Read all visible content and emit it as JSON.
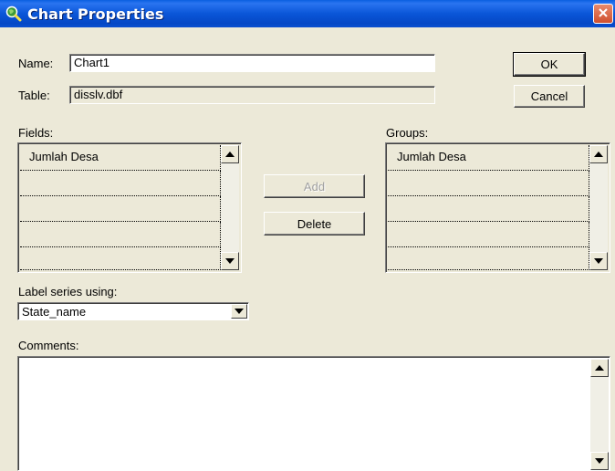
{
  "window": {
    "title": "Chart Properties"
  },
  "form": {
    "name_label": "Name:",
    "name_value": "Chart1",
    "table_label": "Table:",
    "table_value": "disslv.dbf"
  },
  "buttons": {
    "ok": "OK",
    "cancel": "Cancel",
    "add": "Add",
    "delete": "Delete"
  },
  "fields": {
    "label": "Fields:",
    "items": [
      "Jumlah Desa",
      "",
      "",
      "",
      ""
    ]
  },
  "groups": {
    "label": "Groups:",
    "items": [
      "Jumlah Desa",
      "",
      "",
      "",
      ""
    ]
  },
  "label_series": {
    "label": "Label series using:",
    "selected": "State_name"
  },
  "comments": {
    "label": "Comments:",
    "value": ""
  },
  "icons": {
    "app": "globe-magnifier-icon",
    "close": "close-icon"
  },
  "colors": {
    "titlebar": "#0a56d8",
    "close_button": "#d0502e",
    "dialog_bg": "#ece9d8"
  }
}
